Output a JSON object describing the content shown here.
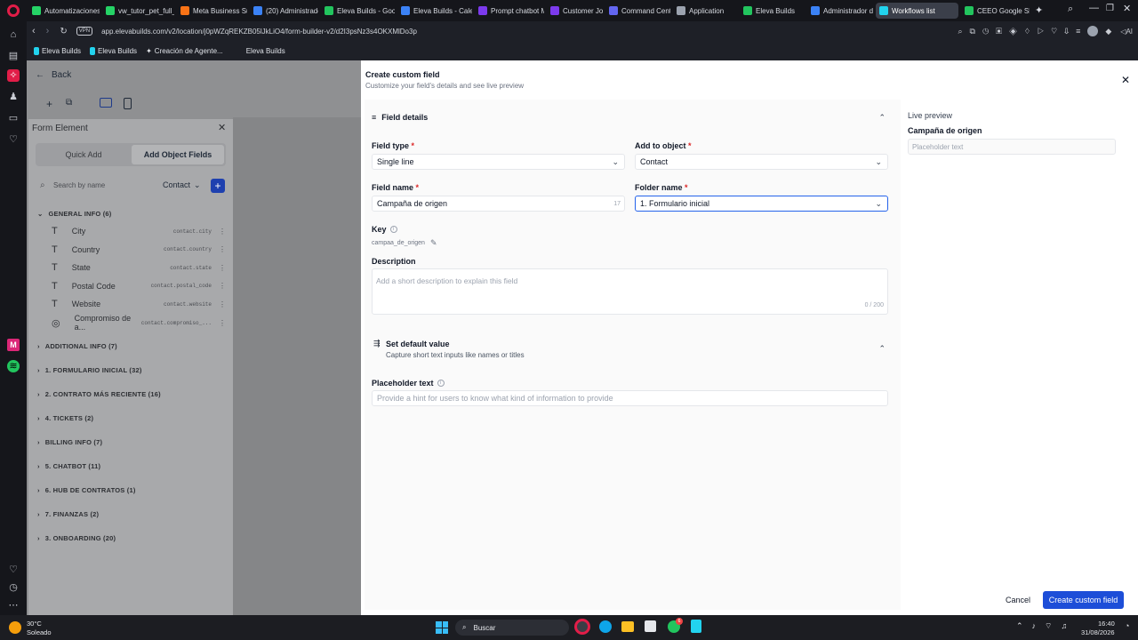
{
  "browser": {
    "tabs": [
      {
        "label": "Automatizaciones",
        "color": "#25d366"
      },
      {
        "label": "vw_tutor_pet_full_c",
        "color": "#25d366"
      },
      {
        "label": "Meta Business Suit",
        "color": "#f97316"
      },
      {
        "label": "(20) Administrado",
        "color": "#3b82f6"
      },
      {
        "label": "Eleva Builds - Goo",
        "color": "#22c55e"
      },
      {
        "label": "Eleva Builds - Cale",
        "color": "#3b82f6"
      },
      {
        "label": "Prompt chatbot M",
        "color": "#7c3aed"
      },
      {
        "label": "Customer Journey",
        "color": "#7c3aed"
      },
      {
        "label": "Command Center",
        "color": "#6366f1"
      },
      {
        "label": "Application",
        "color": "#9ca3af"
      },
      {
        "label": "Eleva Builds",
        "color": "#22c55e"
      },
      {
        "label": "Administrador de",
        "color": "#3b82f6"
      },
      {
        "label": "Workflows list",
        "color": "#22d3ee"
      },
      {
        "label": "CEEO Google Shee",
        "color": "#22c55e"
      }
    ],
    "active_tab_index": 12,
    "url": "app.elevabuilds.com/v2/location/j0pWZqREKZB05lJkLiO4/form-builder-v2/d2I3psNz3s4OKXMlDo3p",
    "vpn_label": "VPN",
    "ai_label": "AI",
    "bookmarks": [
      "Eleva Builds",
      "Eleva Builds",
      "Creación de Agente...",
      "Eleva Builds"
    ]
  },
  "builder": {
    "back_label": "Back",
    "panel_title": "Form Element",
    "tabs": [
      "Quick Add",
      "Add Object Fields"
    ],
    "active_tab": "Add Object Fields",
    "search_placeholder": "Search by name",
    "object_select": "Contact",
    "general_group": "GENERAL INFO (6)",
    "general_items": [
      {
        "label": "City",
        "key": "contact.city",
        "icon": "text-icon"
      },
      {
        "label": "Country",
        "key": "contact.country",
        "icon": "text-icon"
      },
      {
        "label": "State",
        "key": "contact.state",
        "icon": "text-icon"
      },
      {
        "label": "Postal Code",
        "key": "contact.postal_code",
        "icon": "text-icon"
      },
      {
        "label": "Website",
        "key": "contact.website",
        "icon": "text-icon"
      },
      {
        "label": "Compromiso de a...",
        "key": "contact.compromiso_...",
        "icon": "radio-icon"
      }
    ],
    "groups": [
      "ADDITIONAL INFO (7)",
      "1. FORMULARIO INICIAL (32)",
      "2. CONTRATO MÁS RECIENTE (16)",
      "4. TICKETS (2)",
      "BILLING INFO (7)",
      "5. CHATBOT (11)",
      "6. HUB DE CONTRATOS (1)",
      "7. FINANZAS (2)",
      "3. ONBOARDING (20)"
    ]
  },
  "modal": {
    "title": "Create custom field",
    "subtitle": "Customize your field's details and see live preview",
    "section_title": "Field details",
    "field_type_label": "Field type",
    "field_type_value": "Single line",
    "add_to_object_label": "Add to object",
    "add_to_object_value": "Contact",
    "field_name_label": "Field name",
    "field_name_value": "Campaña de origen",
    "field_name_count": "17",
    "folder_label": "Folder name",
    "folder_value": "1. Formulario inicial",
    "key_label": "Key",
    "key_value": "campaa_de_origen",
    "description_label": "Description",
    "description_placeholder": "Add a short description to explain this field",
    "description_count": "0 / 200",
    "default_title": "Set default value",
    "default_subtitle": "Capture short text inputs like names or titles",
    "placeholder_label": "Placeholder text",
    "placeholder_placeholder": "Provide a hint for users to know what kind of information to provide",
    "preview_title": "Live preview",
    "preview_field_label": "Campaña de origen",
    "preview_placeholder": "Placeholder text",
    "cancel_label": "Cancel",
    "create_label": "Create custom field",
    "accent": "#1d4ed8"
  },
  "taskbar": {
    "weather_temp": "30°C",
    "weather_desc": "Soleado",
    "search_label": "Buscar",
    "time": "16:40",
    "date": "31/08/2026",
    "notif_badge": "6"
  }
}
